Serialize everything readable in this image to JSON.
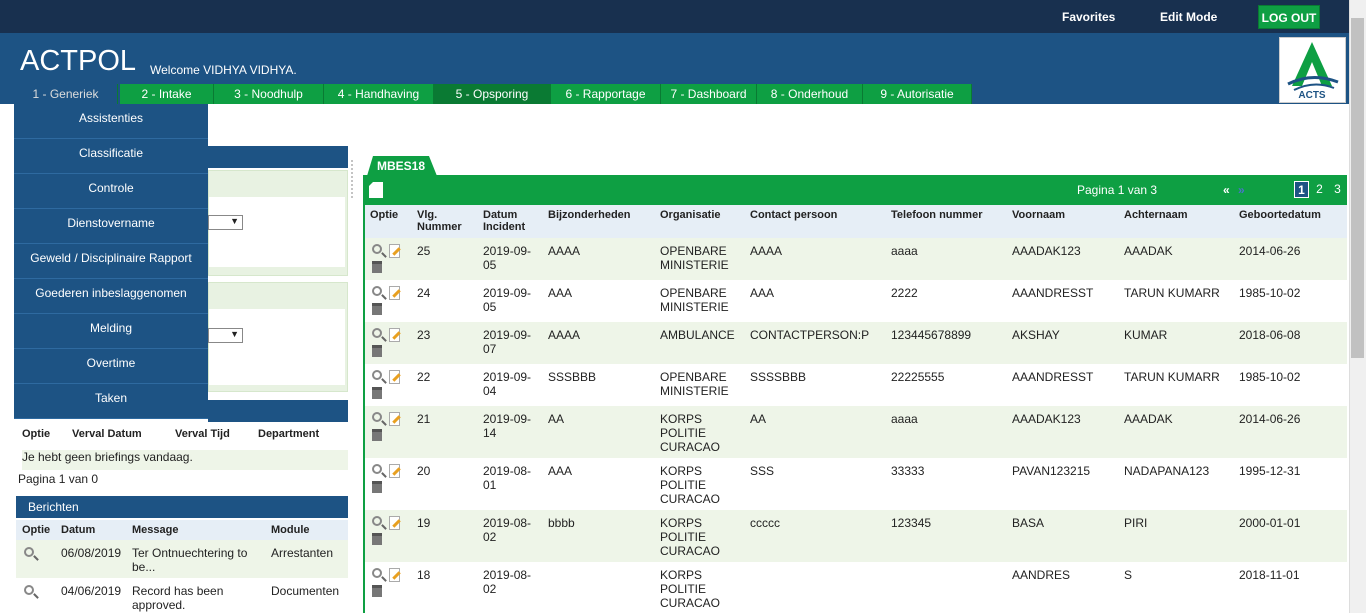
{
  "topbar": {
    "favorites": "Favorites",
    "edit_mode": "Edit Mode",
    "logout": "LOG OUT"
  },
  "header": {
    "app_title": "ACTPOL",
    "welcome": "Welcome VIDHYA VIDHYA.",
    "logo_text": "ACTS"
  },
  "tabs": [
    "1 - Generiek",
    "2 - Intake",
    "3 - Noodhulp",
    "4 - Handhaving",
    "5 - Opsporing",
    "6 - Rapportage",
    "7 - Dashboard",
    "8 - Onderhoud",
    "9 - Autorisatie"
  ],
  "dropdown": [
    "Assistenties",
    "Classificatie",
    "Controle",
    "Dienstovername",
    "Geweld / Disciplinaire Rapport",
    "Goederen inbeslaggenomen",
    "Melding",
    "Overtime",
    "Taken"
  ],
  "briefings": {
    "columns": [
      "Optie",
      "Verval Datum",
      "Verval Tijd",
      "Department"
    ],
    "empty": "Je hebt geen briefings vandaag.",
    "pagina": "Pagina 1 van 0"
  },
  "berichten": {
    "title": "Berichten",
    "columns": [
      "Optie",
      "Datum",
      "Message",
      "Module"
    ],
    "rows": [
      {
        "datum": "06/08/2019",
        "message": "Ter Ontnuechtering to be...",
        "module": "Arrestanten"
      },
      {
        "datum": "04/06/2019",
        "message": "Record has been approved.",
        "module": "Documenten"
      }
    ]
  },
  "mbes": {
    "tab": "MBES18",
    "pagina": "Pagina 1 van 3",
    "nav_first": "«",
    "nav_prev": "»",
    "pages": [
      "1",
      "2",
      "3"
    ],
    "columns": [
      "Optie",
      "Vlg. Nummer",
      "Datum Incident",
      "Bijzonderheden",
      "Organisatie",
      "Contact persoon",
      "Telefoon nummer",
      "Voornaam",
      "Achternaam",
      "Geboortedatum"
    ],
    "rows": [
      {
        "vlg": "25",
        "datum": "2019-09-05",
        "bijz": "AAAA",
        "org": "OPENBARE MINISTERIE",
        "contact": "AAAA",
        "tel": "aaaa",
        "voornaam": "AAADAK123",
        "achternaam": "AAADAK",
        "geb": "2014-06-26"
      },
      {
        "vlg": "24",
        "datum": "2019-09-05",
        "bijz": "AAA",
        "org": "OPENBARE MINISTERIE",
        "contact": "AAA",
        "tel": "2222",
        "voornaam": "AAANDRESST",
        "achternaam": "TARUN KUMARR",
        "geb": "1985-10-02"
      },
      {
        "vlg": "23",
        "datum": "2019-09-07",
        "bijz": "AAAA",
        "org": "AMBULANCE",
        "contact": "CONTACTPERSON:P",
        "tel": "123445678899",
        "voornaam": "AKSHAY",
        "achternaam": "KUMAR",
        "geb": "2018-06-08"
      },
      {
        "vlg": "22",
        "datum": "2019-09-04",
        "bijz": "SSSBBB",
        "org": "OPENBARE MINISTERIE",
        "contact": "SSSSBBB",
        "tel": "22225555",
        "voornaam": "AAANDRESST",
        "achternaam": "TARUN KUMARR",
        "geb": "1985-10-02"
      },
      {
        "vlg": "21",
        "datum": "2019-09-14",
        "bijz": "AA",
        "org": "KORPS POLITIE CURACAO",
        "contact": "AA",
        "tel": "aaaa",
        "voornaam": "AAADAK123",
        "achternaam": "AAADAK",
        "geb": "2014-06-26"
      },
      {
        "vlg": "20",
        "datum": "2019-08-01",
        "bijz": "AAA",
        "org": "KORPS POLITIE CURACAO",
        "contact": "SSS",
        "tel": "33333",
        "voornaam": "PAVAN123215",
        "achternaam": "NADAPANA123",
        "geb": "1995-12-31"
      },
      {
        "vlg": "19",
        "datum": "2019-08-02",
        "bijz": "bbbb",
        "org": "KORPS POLITIE CURACAO",
        "contact": "ccccc",
        "tel": "123345",
        "voornaam": "BASA",
        "achternaam": "PIRI",
        "geb": "2000-01-01"
      },
      {
        "vlg": "18",
        "datum": "2019-08-02",
        "bijz": "",
        "org": "KORPS POLITIE CURACAO",
        "contact": "",
        "tel": "",
        "voornaam": "AANDRES",
        "achternaam": "S",
        "geb": "2018-11-01"
      }
    ]
  }
}
